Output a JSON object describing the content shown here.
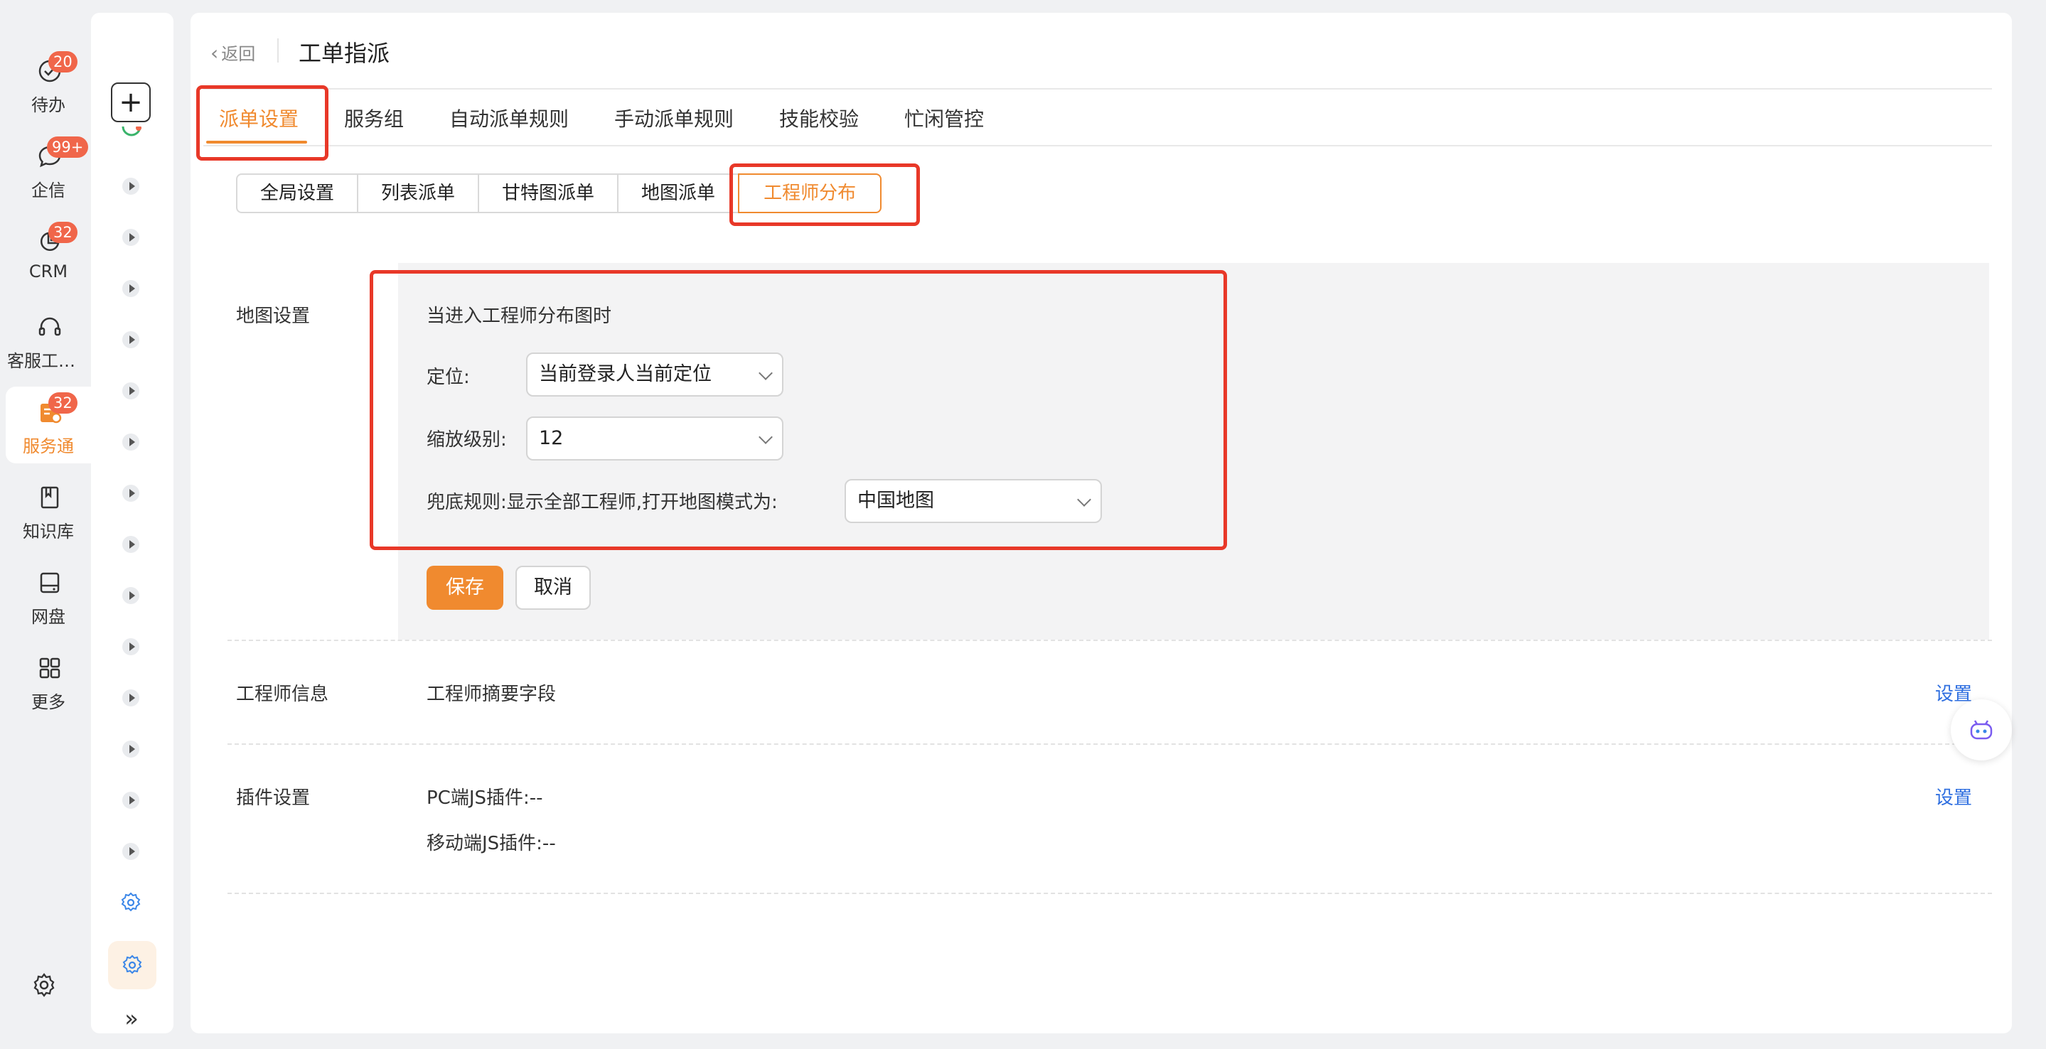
{
  "left_nav": {
    "items": [
      {
        "label": "待办",
        "icon": "check-circle-icon",
        "badge": "20"
      },
      {
        "label": "企信",
        "icon": "chat-bubble-icon",
        "badge": "99+"
      },
      {
        "label": "CRM",
        "icon": "pie-chart-icon",
        "badge": "32"
      },
      {
        "label": "客服工作台",
        "icon": "headset-icon",
        "badge": ""
      },
      {
        "label": "服务通",
        "icon": "service-ticket-icon",
        "badge": "32",
        "active": true
      },
      {
        "label": "知识库",
        "icon": "book-icon",
        "badge": ""
      },
      {
        "label": "网盘",
        "icon": "disk-icon",
        "badge": ""
      },
      {
        "label": "更多",
        "icon": "grid-icon",
        "badge": ""
      }
    ],
    "settings_icon": "gear-icon"
  },
  "header": {
    "back_label": "返回",
    "title": "工单指派"
  },
  "tabs": [
    {
      "label": "派单设置",
      "active": true
    },
    {
      "label": "服务组"
    },
    {
      "label": "自动派单规则"
    },
    {
      "label": "手动派单规则"
    },
    {
      "label": "技能校验"
    },
    {
      "label": "忙闲管控"
    }
  ],
  "sub_tabs": [
    {
      "label": "全局设置"
    },
    {
      "label": "列表派单"
    },
    {
      "label": "甘特图派单"
    },
    {
      "label": "地图派单"
    },
    {
      "label": "工程师分布",
      "active": true
    }
  ],
  "map_settings": {
    "label": "地图设置",
    "heading": "当进入工程师分布图时",
    "location_label": "定位:",
    "location_value": "当前登录人当前定位",
    "zoom_label": "缩放级别:",
    "zoom_value": "12",
    "fallback_label": "兜底规则:显示全部工程师,打开地图模式为:",
    "fallback_value": "中国地图",
    "save_label": "保存",
    "cancel_label": "取消"
  },
  "engineer_info": {
    "label": "工程师信息",
    "value": "工程师摘要字段",
    "link": "设置"
  },
  "plugin_settings": {
    "label": "插件设置",
    "pc_plugin": "PC端JS插件:--",
    "mobile_plugin": "移动端JS插件:--",
    "link": "设置"
  },
  "colors": {
    "accent": "#f08a2f",
    "badge": "#f0664a",
    "highlight": "#e83828",
    "link": "#2f6fe0"
  }
}
